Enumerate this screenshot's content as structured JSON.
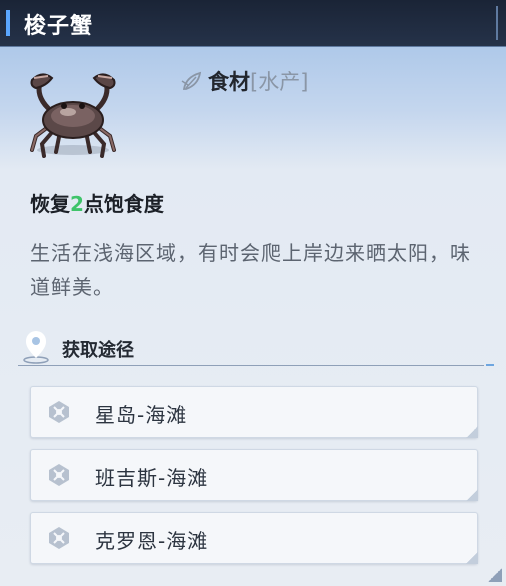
{
  "title": "梭子蟹",
  "item": {
    "icon": "crab-icon",
    "category_icon": "leaf-icon",
    "category": "食材",
    "category_sub": "[水产]",
    "restore_prefix": "恢复",
    "restore_value": "2",
    "restore_suffix": "点饱食度",
    "description": "生活在浅海区域，有时会爬上岸边来晒太阳，味道鲜美。"
  },
  "sources": {
    "icon": "location-pin-icon",
    "label": "获取途径",
    "items": [
      {
        "label": "星岛-海滩",
        "icon": "portal-icon"
      },
      {
        "label": "班吉斯-海滩",
        "icon": "portal-icon"
      },
      {
        "label": "克罗恩-海滩",
        "icon": "portal-icon"
      }
    ]
  },
  "colors": {
    "accent": "#5aa6ff",
    "highlight": "#3fc46a",
    "title_bar": "#1a2436"
  }
}
